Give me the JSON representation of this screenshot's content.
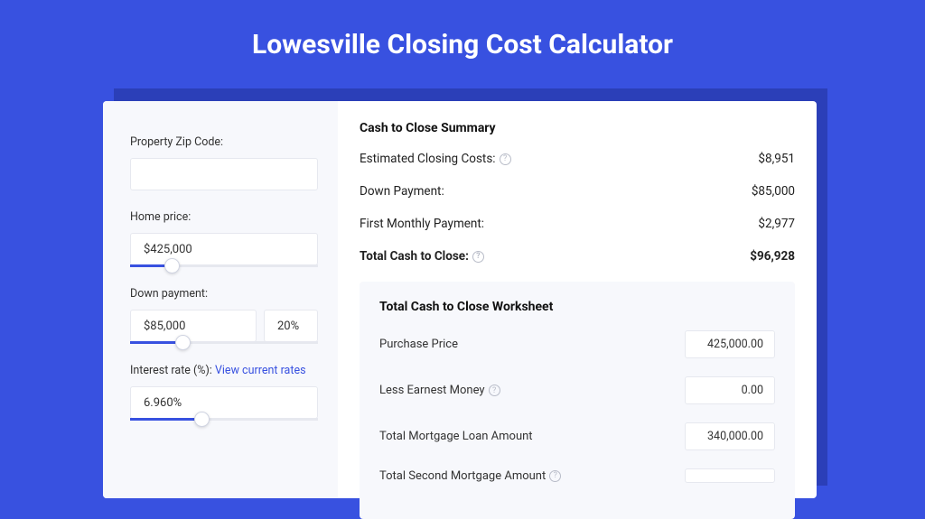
{
  "title": "Lowesville Closing Cost Calculator",
  "form": {
    "zip_label": "Property Zip Code:",
    "zip_value": "",
    "home_price_label": "Home price:",
    "home_price_value": "$425,000",
    "home_price_fill_pct": 22,
    "down_payment_label": "Down payment:",
    "down_payment_value": "$85,000",
    "down_payment_pct": "20%",
    "down_payment_fill_pct": 28,
    "interest_label": "Interest rate (%): ",
    "interest_link": "View current rates",
    "interest_value": "6.960%",
    "interest_fill_pct": 38
  },
  "summary": {
    "heading": "Cash to Close Summary",
    "rows": [
      {
        "label": "Estimated Closing Costs:",
        "help": true,
        "value": "$8,951",
        "bold": false
      },
      {
        "label": "Down Payment:",
        "help": false,
        "value": "$85,000",
        "bold": false
      },
      {
        "label": "First Monthly Payment:",
        "help": false,
        "value": "$2,977",
        "bold": false
      },
      {
        "label": "Total Cash to Close:",
        "help": true,
        "value": "$96,928",
        "bold": true
      }
    ]
  },
  "worksheet": {
    "heading": "Total Cash to Close Worksheet",
    "rows": [
      {
        "label": "Purchase Price",
        "help": false,
        "value": "425,000.00"
      },
      {
        "label": "Less Earnest Money",
        "help": true,
        "value": "0.00"
      },
      {
        "label": "Total Mortgage Loan Amount",
        "help": false,
        "value": "340,000.00"
      },
      {
        "label": "Total Second Mortgage Amount",
        "help": true,
        "value": ""
      }
    ]
  }
}
